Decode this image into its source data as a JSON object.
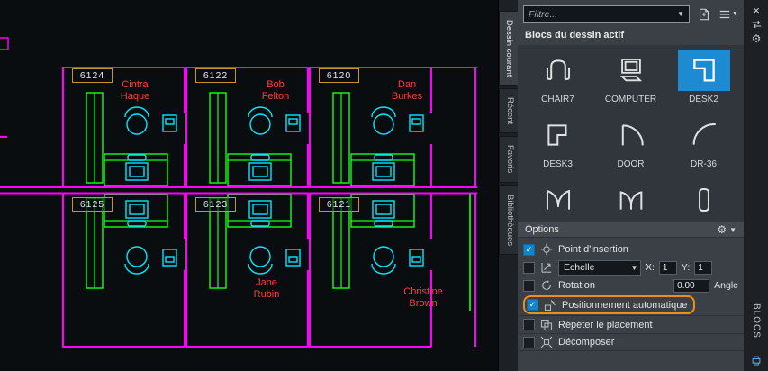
{
  "drawing": {
    "rooms": [
      {
        "number": "6124",
        "name": "Cintra Haque"
      },
      {
        "number": "6122",
        "name": "Bob Felton"
      },
      {
        "number": "6120",
        "name": "Dan Burkes"
      },
      {
        "number": "6125",
        "name": ""
      },
      {
        "number": "6123",
        "name": "Jane Rubin"
      },
      {
        "number": "6121",
        "name": "Christine Brown"
      }
    ],
    "colors": {
      "walls": "#ff00ff",
      "furniture": "#19ff19",
      "equipment": "#00e8ff",
      "room_box_border": "#c8922c",
      "occupant_text": "#ff3c3c"
    }
  },
  "palette": {
    "filter_placeholder": "Filtre...",
    "section_title": "Blocs du dessin actif",
    "side_label": "BLOCS",
    "tabs": [
      {
        "label": "Dessin courant",
        "active": true
      },
      {
        "label": "Récent",
        "active": false
      },
      {
        "label": "Favoris",
        "active": false
      },
      {
        "label": "Bibliothèques",
        "active": false
      }
    ],
    "blocks": [
      {
        "label": "CHAIR7",
        "icon": "chair-icon",
        "selected": false
      },
      {
        "label": "COMPUTER",
        "icon": "computer-icon",
        "selected": false
      },
      {
        "label": "DESK2",
        "icon": "desk2-icon",
        "selected": true
      },
      {
        "label": "DESK3",
        "icon": "desk3-icon",
        "selected": false
      },
      {
        "label": "DOOR",
        "icon": "door-icon",
        "selected": false
      },
      {
        "label": "DR-36",
        "icon": "dr36-icon",
        "selected": false
      },
      {
        "label": "",
        "icon": "double-door-icon",
        "selected": false
      },
      {
        "label": "",
        "icon": "double-door2-icon",
        "selected": false
      },
      {
        "label": "",
        "icon": "tall-block-icon",
        "selected": false
      }
    ],
    "options": {
      "title": "Options",
      "insertion_point": {
        "label": "Point d'insertion",
        "checked": true
      },
      "scale": {
        "label": "Echelle",
        "value": "Echelle",
        "checked": false,
        "x_label": "X:",
        "x_value": "1",
        "y_label": "Y:",
        "y_value": "1"
      },
      "rotation": {
        "label": "Rotation",
        "checked": false,
        "angle_value": "0.00",
        "angle_label": "Angle"
      },
      "auto_placement": {
        "label": "Positionnement automatique",
        "checked": true,
        "highlighted": true,
        "highlight_color": "#ee8d1f"
      },
      "repeat_placement": {
        "label": "Répéter le placement",
        "checked": false
      },
      "explode": {
        "label": "Décomposer",
        "checked": false
      }
    }
  }
}
